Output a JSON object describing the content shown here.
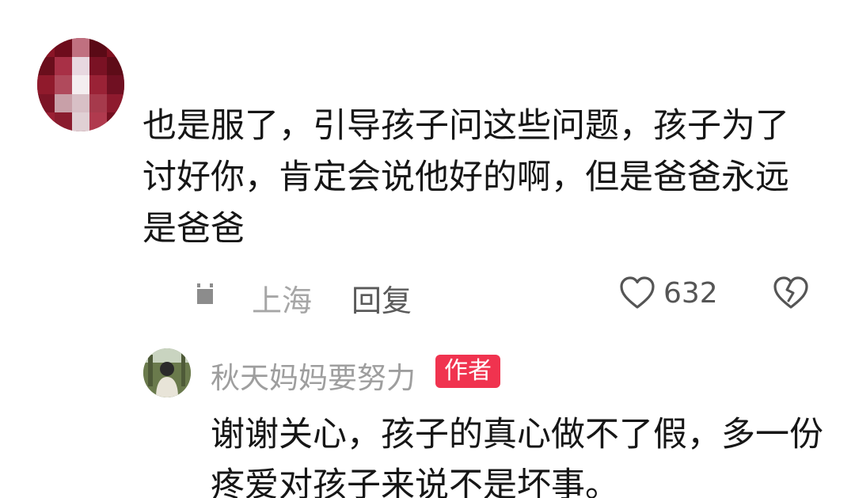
{
  "comment": {
    "username": "",
    "text": "也是服了，引导孩子问这些问题，孩子为了讨好你，肯定会说他好的啊，但是爸爸永远是爸爸",
    "location": "上海",
    "reply_label": "回复",
    "like_count": "632",
    "icons": {
      "like": "heart-outline-icon",
      "dislike": "broken-heart-icon"
    }
  },
  "reply": {
    "username": "秋天妈妈要努力",
    "badge": "作者",
    "text": "谢谢关心，孩子的真心做不了假，多一份疼爱对孩子来说不是坏事。"
  },
  "colors": {
    "badge_bg": "#f0334f",
    "text": "#161616",
    "muted": "#a6a6a6"
  }
}
